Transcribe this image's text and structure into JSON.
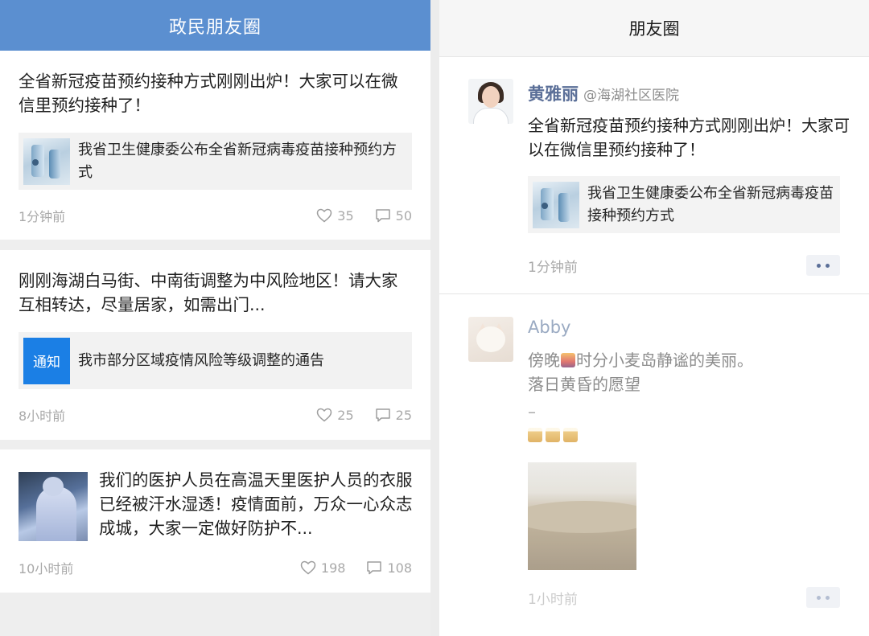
{
  "left": {
    "header_title": "政民朋友圈",
    "cards": [
      {
        "text": "全省新冠疫苗预约接种方式刚刚出炉！大家可以在微信里预约接种了！",
        "link_text": "我省卫生健康委公布全省新冠病毒疫苗接种预约方式",
        "link_thumb_icon": "medical-vials-thumbnail",
        "time": "1分钟前",
        "likes": "35",
        "comments": "50"
      },
      {
        "text": "刚刚海湖白马街、中南街调整为中风险地区！请大家互相转达，尽量居家，如需出门...",
        "link_badge": "通知",
        "link_text": "我市部分区域疫情风险等级调整的通告",
        "time": "8小时前",
        "likes": "25",
        "comments": "25"
      },
      {
        "text": "我们的医护人员在高温天里医护人员的衣服已经被汗水湿透！疫情面前，万众一心众志成城，大家一定做好防护不...",
        "photo_icon": "medical-worker-photo",
        "time": "10小时前",
        "likes": "198",
        "comments": "108"
      }
    ]
  },
  "right": {
    "header_title": "朋友圈",
    "posts": [
      {
        "name": "黄雅丽",
        "handle": "@海湖社区医院",
        "text": "全省新冠疫苗预约接种方式刚刚出炉！大家可以在微信里预约接种了！",
        "link_text": "我省卫生健康委公布全省新冠病毒疫苗接种预约方式",
        "time": "1分钟前"
      },
      {
        "name": "Abby",
        "text_before_emoji": "傍晚",
        "text_after_emoji": "时分小麦岛静谧的美丽。",
        "text_line2": "落日黄昏的愿望",
        "dash": "–",
        "time": "1小时前"
      }
    ]
  },
  "colors": {
    "left_header_bg": "#5b8fd0",
    "name_color": "#5b6f98",
    "notice_badge_bg": "#1b7fe5"
  }
}
